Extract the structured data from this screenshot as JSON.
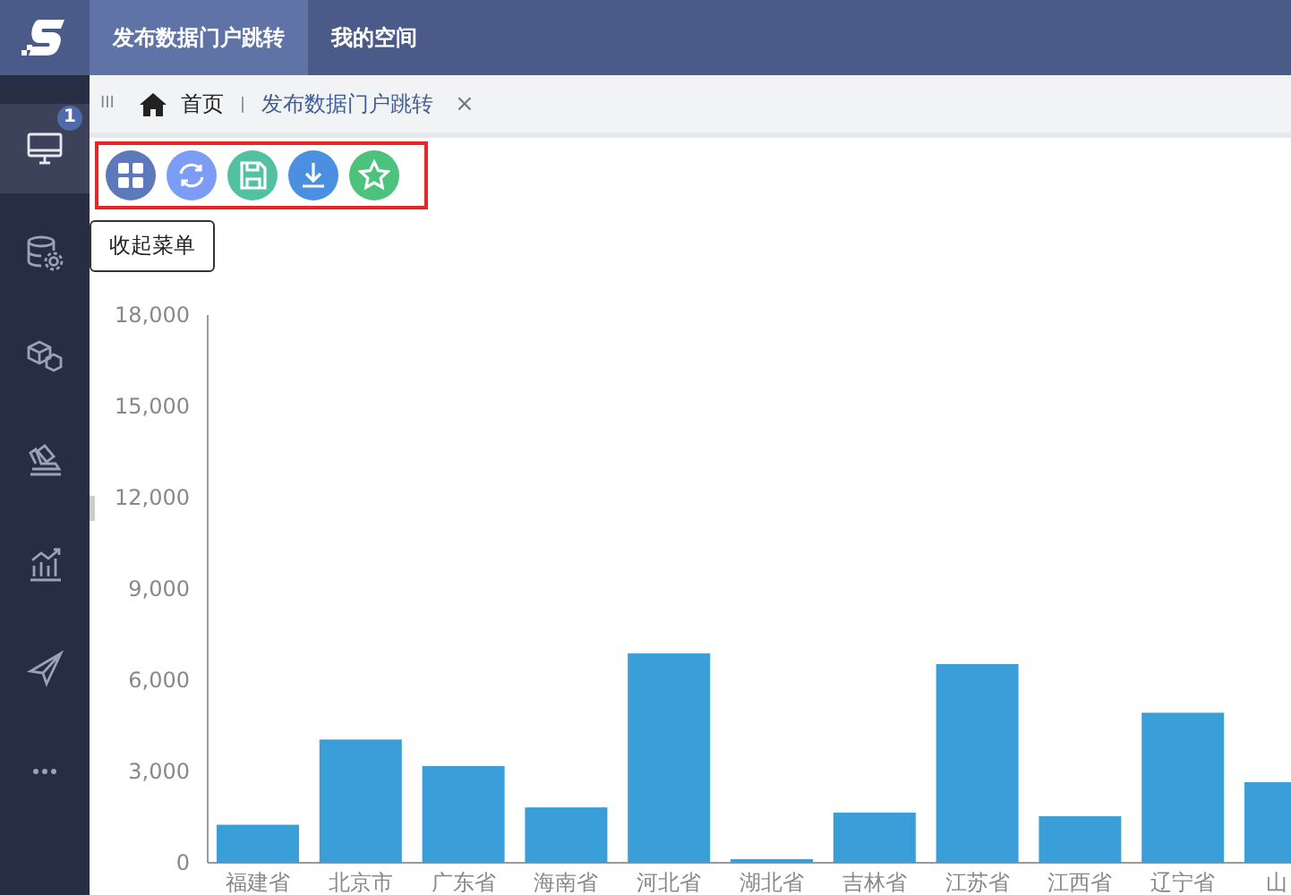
{
  "top_tabs": [
    {
      "label": "发布数据门户跳转",
      "selected": true
    },
    {
      "label": "我的空间",
      "selected": false
    }
  ],
  "sidebar": {
    "items": [
      {
        "selected": true,
        "badge": "1"
      },
      {
        "selected": false
      },
      {
        "selected": false
      },
      {
        "selected": false
      },
      {
        "selected": false
      },
      {
        "selected": false
      },
      {
        "selected": false
      }
    ]
  },
  "breadcrumb": {
    "menu": "III",
    "home": "首页",
    "page": "发布数据门户跳转",
    "close": "×"
  },
  "toolbar": {
    "highlighted": true,
    "buttons": [
      {
        "color": "#5b79bb"
      },
      {
        "color": "#7c9df6"
      },
      {
        "color": "#52c1a1"
      },
      {
        "color": "#4a8fe0"
      },
      {
        "color": "#4dc27d"
      }
    ]
  },
  "tooltip": "收起菜单",
  "chart_data": {
    "type": "bar",
    "categories": [
      "福建省",
      "北京市",
      "广东省",
      "海南省",
      "河北省",
      "湖北省",
      "吉林省",
      "江苏省",
      "江西省",
      "辽宁省",
      "山"
    ],
    "series": [
      {
        "color": "#3a9fd9",
        "values": [
          1250,
          4050,
          3180,
          1820,
          6880,
          120,
          1650,
          6530,
          1530,
          4930,
          2650
        ]
      }
    ],
    "ylim": [
      0,
      18000
    ],
    "yticks": [
      {
        "value": 0,
        "label": "0"
      },
      {
        "value": 3000,
        "label": "3,000"
      },
      {
        "value": 6000,
        "label": "6,000"
      },
      {
        "value": 9000,
        "label": "9,000"
      },
      {
        "value": 12000,
        "label": "12,000"
      },
      {
        "value": 15000,
        "label": "15,000"
      },
      {
        "value": 18000,
        "label": "18,000"
      }
    ]
  }
}
